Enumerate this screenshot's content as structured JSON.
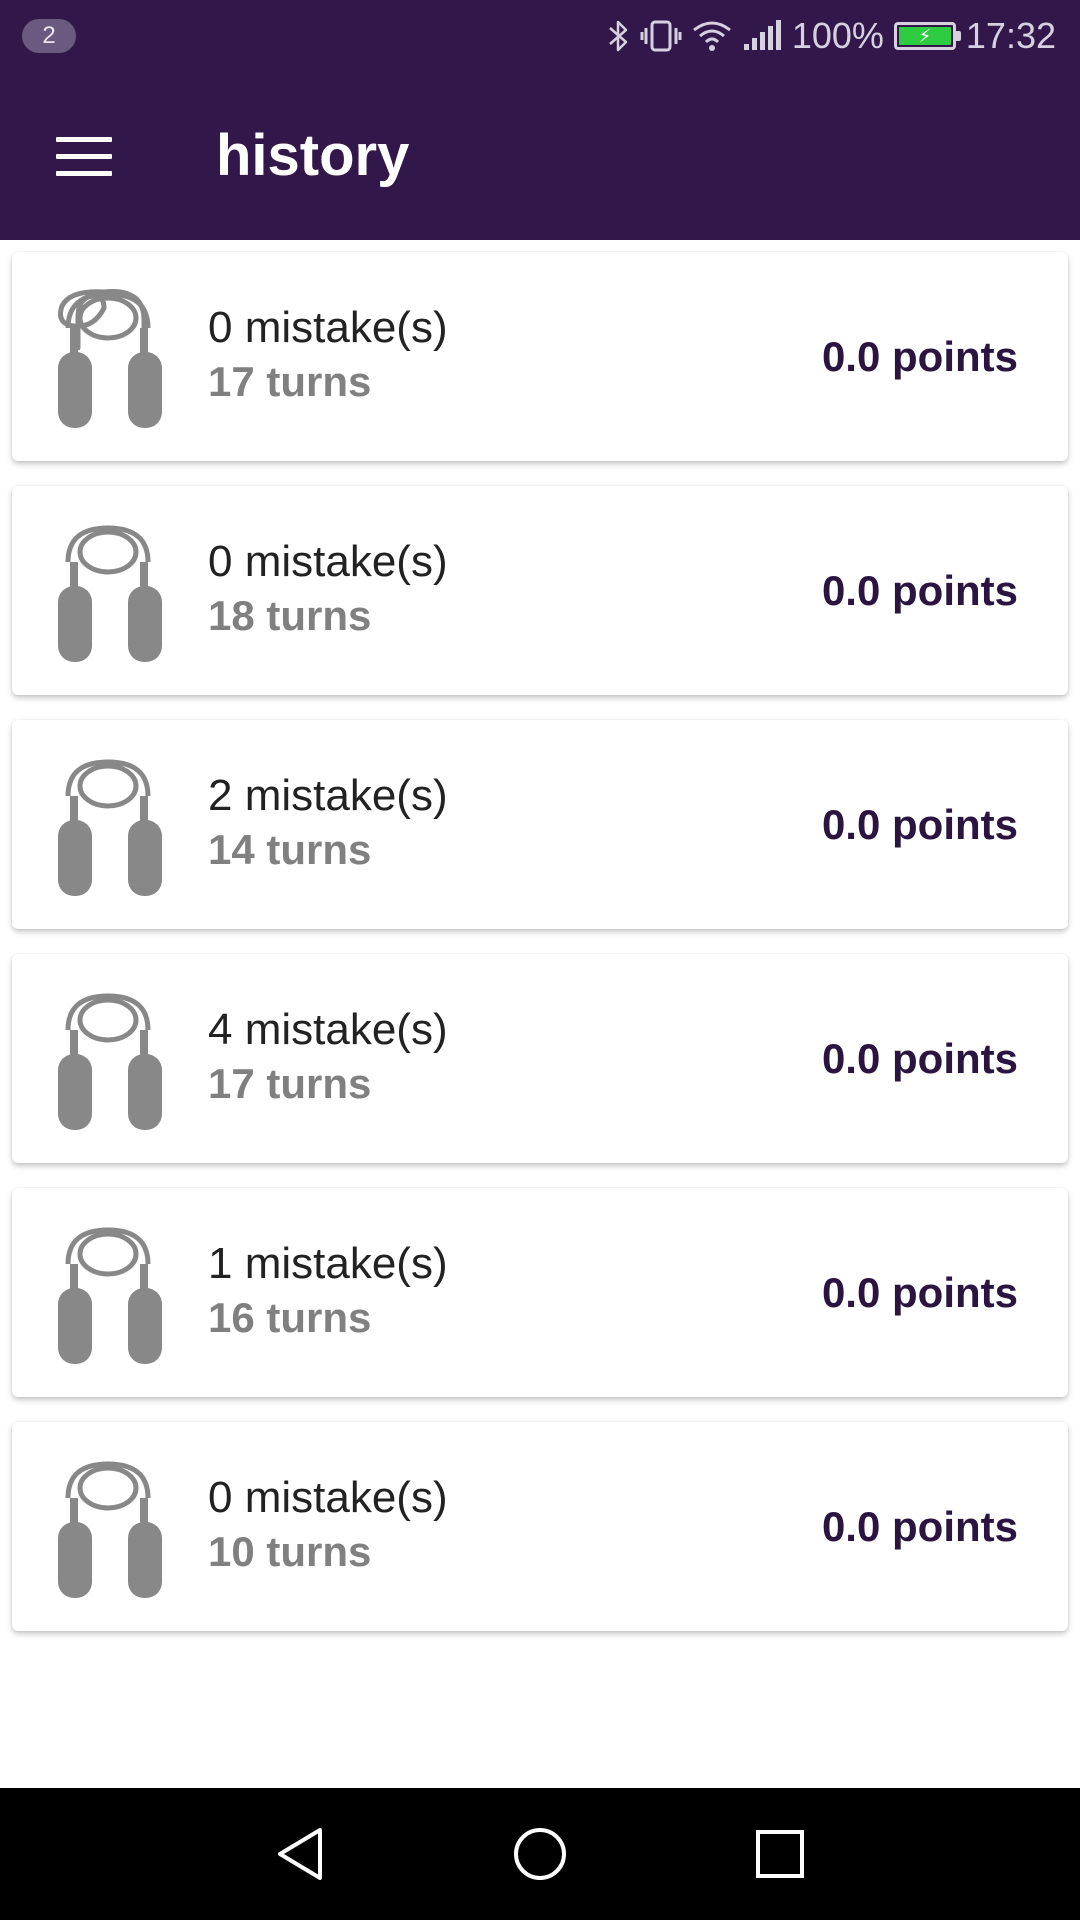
{
  "status_bar": {
    "notification_count": "2",
    "battery_percent": "100%",
    "time": "17:32",
    "icons": [
      "bluetooth-icon",
      "vibrate-icon",
      "wifi-icon",
      "signal-icon",
      "battery-charging-icon"
    ],
    "battery_color": "#2ecc40"
  },
  "app_bar": {
    "title": "history",
    "menu_icon": "hamburger-menu-icon",
    "background": "#32184a"
  },
  "history": {
    "items": [
      {
        "mistakes": "0 mistake(s)",
        "turns": "17 turns",
        "points": "0.0 points",
        "icon": "jump-rope-icon"
      },
      {
        "mistakes": "0 mistake(s)",
        "turns": "18 turns",
        "points": "0.0 points",
        "icon": "jump-rope-icon"
      },
      {
        "mistakes": "2 mistake(s)",
        "turns": "14 turns",
        "points": "0.0 points",
        "icon": "jump-rope-icon"
      },
      {
        "mistakes": "4 mistake(s)",
        "turns": "17 turns",
        "points": "0.0 points",
        "icon": "jump-rope-icon"
      },
      {
        "mistakes": "1 mistake(s)",
        "turns": "16 turns",
        "points": "0.0 points",
        "icon": "jump-rope-icon"
      },
      {
        "mistakes": "0 mistake(s)",
        "turns": "10 turns",
        "points": "0.0 points",
        "icon": "jump-rope-icon"
      }
    ]
  },
  "nav_bar": {
    "buttons": [
      "back-icon",
      "home-icon",
      "recents-icon"
    ]
  }
}
